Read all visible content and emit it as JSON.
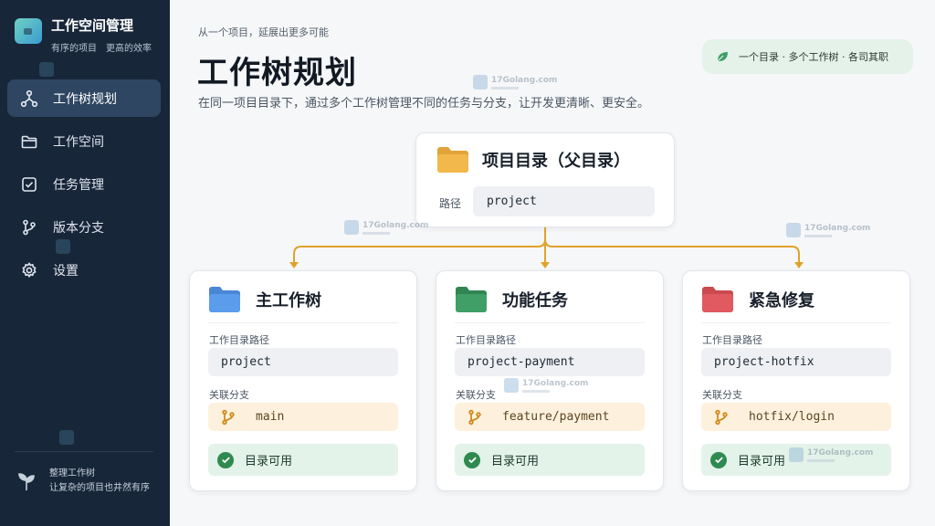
{
  "sidebar": {
    "brand_title": "工作空间管理",
    "brand_subtitle": "有序的项目　更高的效率",
    "items": [
      {
        "label": "工作树规划",
        "icon": "tree-nodes-icon",
        "active": true
      },
      {
        "label": "工作空间",
        "icon": "folder-icon",
        "active": false
      },
      {
        "label": "任务管理",
        "icon": "checkbox-icon",
        "active": false
      },
      {
        "label": "版本分支",
        "icon": "git-branch-icon",
        "active": false
      },
      {
        "label": "设置",
        "icon": "gear-icon",
        "active": false
      }
    ],
    "footer_line1": "整理工作树",
    "footer_line2": "让复杂的项目也井然有序"
  },
  "header": {
    "eyebrow": "从一个项目，延展出更多可能",
    "title": "工作树规划",
    "description": "在同一项目目录下，通过多个工作树管理不同的任务与分支，让开发更清晰、更安全。",
    "pill": "一个目录 · 多个工作树 · 各司其职"
  },
  "parent": {
    "title": "项目目录（父目录）",
    "path_label": "路径",
    "path_value": "project",
    "folder_color": "#f2b84b"
  },
  "worktrees": [
    {
      "title": "主工作树",
      "folder_color": "#5b9cec",
      "path_label": "工作目录路径",
      "path": "project",
      "branch_label": "关联分支",
      "branch": "main",
      "status": "目录可用"
    },
    {
      "title": "功能任务",
      "folder_color": "#3f9f66",
      "path_label": "工作目录路径",
      "path": "project-payment",
      "branch_label": "关联分支",
      "branch": "feature/payment",
      "status": "目录可用"
    },
    {
      "title": "紧急修复",
      "folder_color": "#e05a5f",
      "path_label": "工作目录路径",
      "path": "project-hotfix",
      "branch_label": "关联分支",
      "branch": "hotfix/login",
      "status": "目录可用"
    }
  ],
  "watermark": "17Golang.com",
  "colors": {
    "accent": "#2e4661",
    "connector": "#e0a32a",
    "success": "#2f8a4f"
  }
}
